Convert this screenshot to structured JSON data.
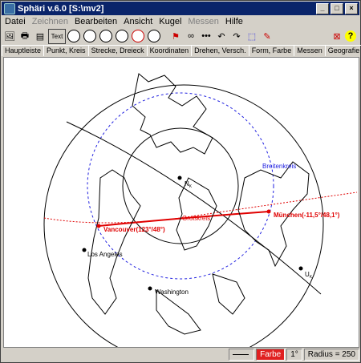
{
  "window": {
    "title": "Sphäri v.6.0   [S:\\mv2]",
    "min": "_",
    "max": "□",
    "close": "×"
  },
  "menu": [
    {
      "label": "Datei",
      "enabled": true
    },
    {
      "label": "Zeichnen",
      "enabled": false
    },
    {
      "label": "Bearbeiten",
      "enabled": true
    },
    {
      "label": "Ansicht",
      "enabled": true
    },
    {
      "label": "Kugel",
      "enabled": true
    },
    {
      "label": "Messen",
      "enabled": false
    },
    {
      "label": "Hilfe",
      "enabled": true
    }
  ],
  "toolbar": {
    "text_label": "Text",
    "help_label": "?",
    "icons": [
      "open-icon",
      "print-icon",
      "print-preview-icon",
      "text-tool-icon",
      "sphere-1-icon",
      "sphere-2-icon",
      "sphere-3-icon",
      "sphere-4-icon",
      "sphere-5-icon",
      "sphere-6-icon",
      "clock-1-icon",
      "clock-2-icon",
      "pin-icon",
      "curve-icon",
      "dots-icon",
      "undo-icon",
      "redo-icon",
      "select-icon",
      "settings-icon",
      "close-doc-icon",
      "help-icon"
    ]
  },
  "tabs": [
    "Hauptleiste",
    "Punkt, Kreis",
    "Strecke, Dreieck",
    "Koordinaten",
    "Drehen, Versch.",
    "Form, Farbe",
    "Messen",
    "Geografie"
  ],
  "labels": {
    "point_n": "N",
    "point_n_sub": "K",
    "point_u": "U",
    "point_u_sub": "K",
    "breitenkreis": "Breitenkreis",
    "grosskreis": "Großkreis",
    "vancouver": "Vancouver(123°/48°)",
    "muenchen": "München(-11,5°/48,1°)",
    "los_angeles": "Los Angeles",
    "washington": "Washington"
  },
  "colors": {
    "accent_red": "#e00000",
    "dashed_blue": "#2020e0",
    "title_bg": "#0a246a"
  },
  "status": {
    "color_label": "Farbe",
    "angle": "1°",
    "radius": "Radius = 250"
  }
}
